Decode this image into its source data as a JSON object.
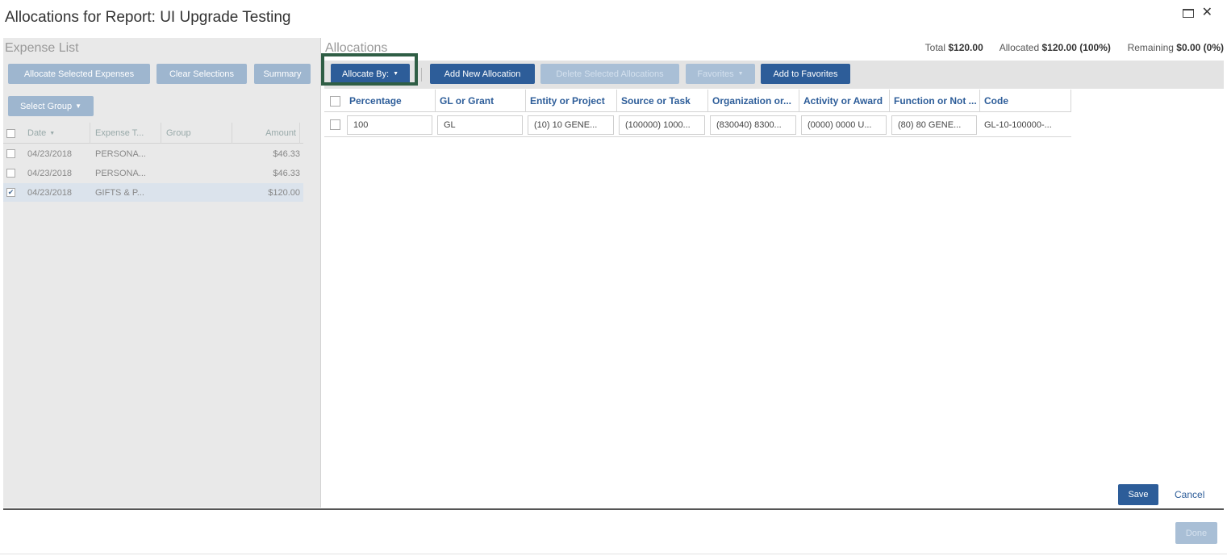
{
  "window": {
    "title": "Allocations for Report: UI Upgrade Testing"
  },
  "expense_list": {
    "title": "Expense List",
    "buttons": {
      "allocate_selected": "Allocate Selected Expenses",
      "clear_selections": "Clear Selections",
      "summary": "Summary"
    },
    "select_group": "Select Group",
    "columns": [
      "Date",
      "Expense T...",
      "Group",
      "Amount"
    ],
    "rows": [
      {
        "date": "04/23/2018",
        "expense_type": "PERSONA...",
        "group": "",
        "amount": "$46.33",
        "checked": false
      },
      {
        "date": "04/23/2018",
        "expense_type": "PERSONA...",
        "group": "",
        "amount": "$46.33",
        "checked": false
      },
      {
        "date": "04/23/2018",
        "expense_type": "GIFTS & P...",
        "group": "",
        "amount": "$120.00",
        "checked": true
      }
    ]
  },
  "allocations": {
    "title": "Allocations",
    "totals": {
      "total_label": "Total",
      "total_value": "$120.00",
      "allocated_label": "Allocated",
      "allocated_value": "$120.00 (100%)",
      "remaining_label": "Remaining",
      "remaining_value": "$0.00 (0%)"
    },
    "toolbar": {
      "allocate_by": "Allocate By:",
      "add_new": "Add New Allocation",
      "delete_selected": "Delete Selected Allocations",
      "favorites": "Favorites",
      "add_to_favorites": "Add to Favorites"
    },
    "columns": [
      "Percentage",
      "GL or Grant",
      "Entity or Project",
      "Source or Task",
      "Organization or...",
      "Activity or Award",
      "Function or Not ...",
      "Code"
    ],
    "row": {
      "percentage": "100",
      "gl_or_grant": "GL",
      "entity": "(10) 10 GENE...",
      "source": "(100000) 1000...",
      "organization": "(830040) 8300...",
      "activity": "(0000) 0000 U...",
      "function": "(80) 80 GENE...",
      "code": "GL-10-100000-..."
    },
    "save": "Save",
    "cancel": "Cancel"
  },
  "footer": {
    "done": "Done"
  }
}
